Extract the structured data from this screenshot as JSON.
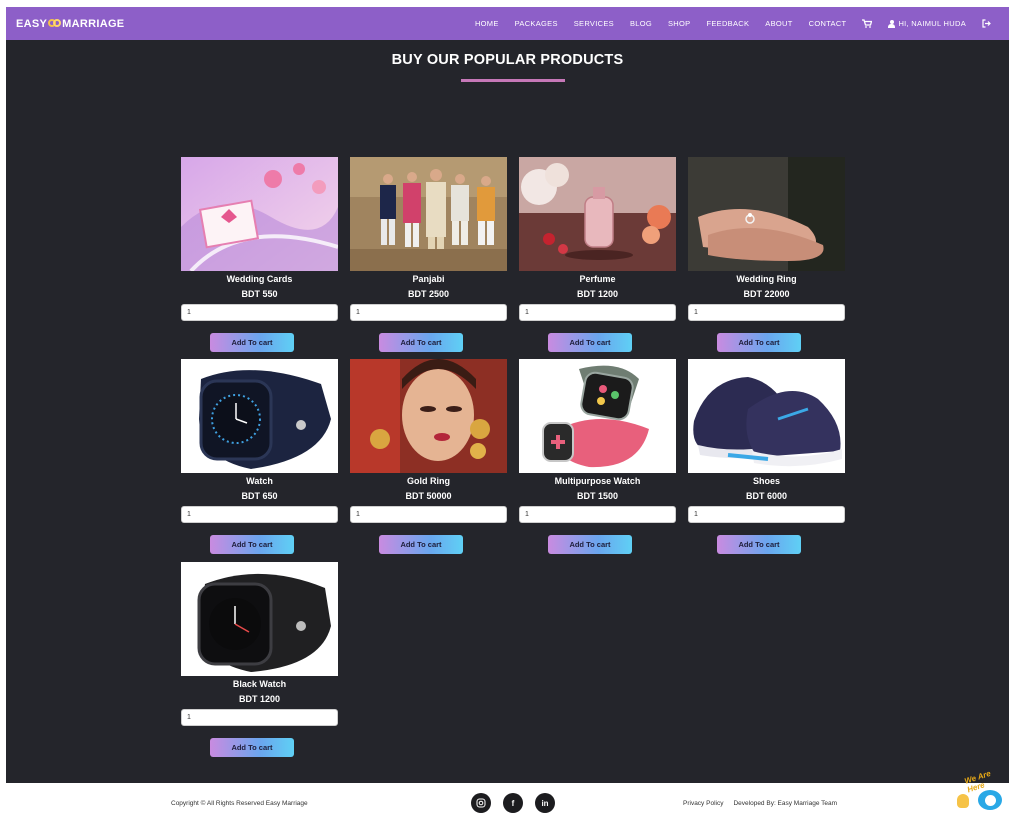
{
  "navbar": {
    "brand_left": "EASY",
    "brand_right": "MARRIAGE",
    "links": [
      "HOME",
      "PACKAGES",
      "SERVICES",
      "BLOG",
      "SHOP",
      "FEEDBACK",
      "ABOUT",
      "CONTACT"
    ],
    "user_label": "HI, NAIMUL HUDA",
    "cart_icon": "cart-icon",
    "logout_icon": "logout-icon"
  },
  "page": {
    "title": "BUY OUR POPULAR PRODUCTS"
  },
  "products": [
    {
      "name": "Wedding Cards",
      "price": "BDT 550",
      "qty": "1",
      "button": "Add To cart",
      "image": "wedding-cards-image"
    },
    {
      "name": "Panjabi",
      "price": "BDT 2500",
      "qty": "1",
      "button": "Add To cart",
      "image": "panjabi-image"
    },
    {
      "name": "Perfume",
      "price": "BDT 1200",
      "qty": "1",
      "button": "Add To cart",
      "image": "perfume-image"
    },
    {
      "name": "Wedding Ring",
      "price": "BDT 22000",
      "qty": "1",
      "button": "Add To cart",
      "image": "wedding-ring-image"
    },
    {
      "name": "Watch",
      "price": "BDT 650",
      "qty": "1",
      "button": "Add To cart",
      "image": "watch-image"
    },
    {
      "name": "Gold Ring",
      "price": "BDT 50000",
      "qty": "1",
      "button": "Add To cart",
      "image": "gold-ring-image"
    },
    {
      "name": "Multipurpose Watch",
      "price": "BDT 1500",
      "qty": "1",
      "button": "Add To cart",
      "image": "multipurpose-watch-image"
    },
    {
      "name": "Shoes",
      "price": "BDT 6000",
      "qty": "1",
      "button": "Add To cart",
      "image": "shoes-image"
    },
    {
      "name": "Black Watch",
      "price": "BDT 1200",
      "qty": "1",
      "button": "Add To cart",
      "image": "black-watch-image"
    }
  ],
  "footer": {
    "copyright": "Copyright © All Rights Reserved Easy Marriage",
    "socials": [
      "instagram-icon",
      "facebook-icon",
      "linkedin-icon"
    ],
    "privacy": "Privacy Policy",
    "developed_by": "Developed By: Easy Marriage Team",
    "help_text": "We Are Here"
  },
  "colors": {
    "navbar": "#8d5fc8",
    "background": "#24252b",
    "title_underline": "#c678b8"
  }
}
